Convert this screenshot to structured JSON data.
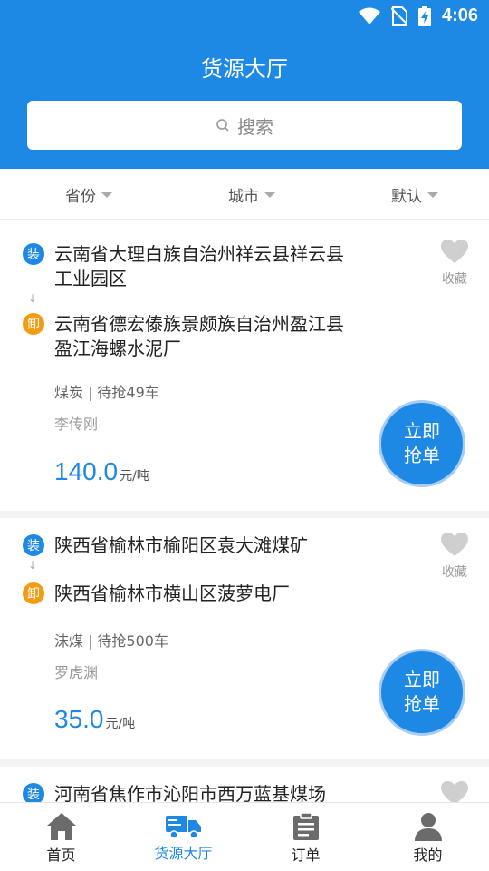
{
  "status_bar": {
    "time": "4:06"
  },
  "header": {
    "title": "货源大厅"
  },
  "search": {
    "placeholder": "搜索"
  },
  "filters": [
    {
      "label": "省份"
    },
    {
      "label": "城市"
    },
    {
      "label": "默认"
    }
  ],
  "cards": [
    {
      "load_badge": "装",
      "load_line1": "云南省大理白族自治州祥云县祥云县",
      "load_line2": "工业园区",
      "unload_badge": "卸",
      "unload_line1": "云南省德宏傣族景颇族自治州盈江县",
      "unload_line2": "盈江海螺水泥厂",
      "cargo": "煤炭",
      "remaining": "待抢49车",
      "contact": "李传刚",
      "price": "140.0",
      "price_unit": "元/吨",
      "favorite_label": "收藏",
      "grab_line1": "立即",
      "grab_line2": "抢单"
    },
    {
      "load_badge": "装",
      "load_line1": "陕西省榆林市榆阳区袁大滩煤矿",
      "unload_badge": "卸",
      "unload_line1": "陕西省榆林市横山区菠萝电厂",
      "cargo": "沫煤",
      "remaining": "待抢500车",
      "contact": "罗虎渊",
      "price": "35.0",
      "price_unit": "元/吨",
      "favorite_label": "收藏",
      "grab_line1": "立即",
      "grab_line2": "抢单"
    },
    {
      "load_badge": "装",
      "load_line1": "河南省焦作市沁阳市西万蓝基煤场"
    }
  ],
  "bottom_nav": [
    {
      "label": "首页",
      "icon": "home-icon"
    },
    {
      "label": "货源大厅",
      "icon": "truck-icon",
      "active": true
    },
    {
      "label": "订单",
      "icon": "clipboard-icon"
    },
    {
      "label": "我的",
      "icon": "user-icon"
    }
  ],
  "colors": {
    "primary": "#1e88e5",
    "load_badge": "#1e88e5",
    "unload_badge": "#f39c12"
  }
}
